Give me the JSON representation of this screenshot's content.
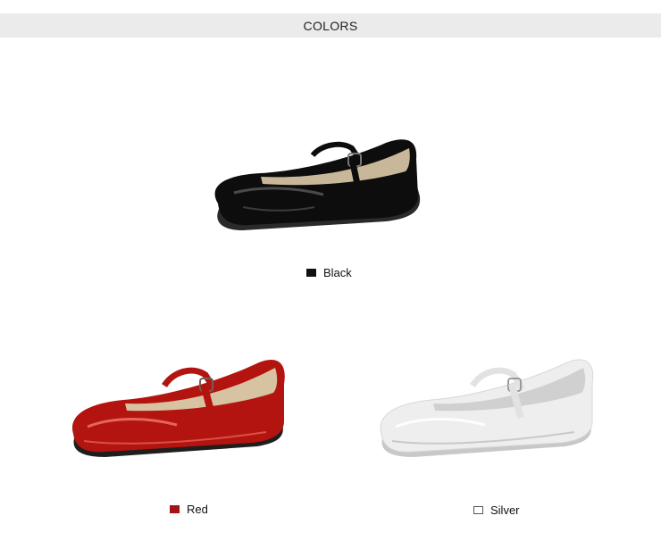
{
  "header": {
    "title": "COLORS"
  },
  "colors": [
    {
      "label": "Black",
      "swatch": "#111111",
      "swatch_border": "#111111"
    },
    {
      "label": "Red",
      "swatch": "#a31515",
      "swatch_border": "#a31515"
    },
    {
      "label": "Silver",
      "swatch": "#ffffff",
      "swatch_border": "#555555"
    }
  ],
  "shoe_colors": {
    "black": {
      "body": "#0d0d0d",
      "highlight": "#5a5a5a",
      "lining": "#c9b79a",
      "sole": "#2a2a2a"
    },
    "red": {
      "body": "#b3140f",
      "highlight": "#f07a6e",
      "lining": "#d7c2a2",
      "sole": "#1e1e1e"
    },
    "silver": {
      "body": "#eeeeee",
      "highlight": "#ffffff",
      "lining": "#d0d0d0",
      "sole": "#c8c8c8"
    }
  }
}
